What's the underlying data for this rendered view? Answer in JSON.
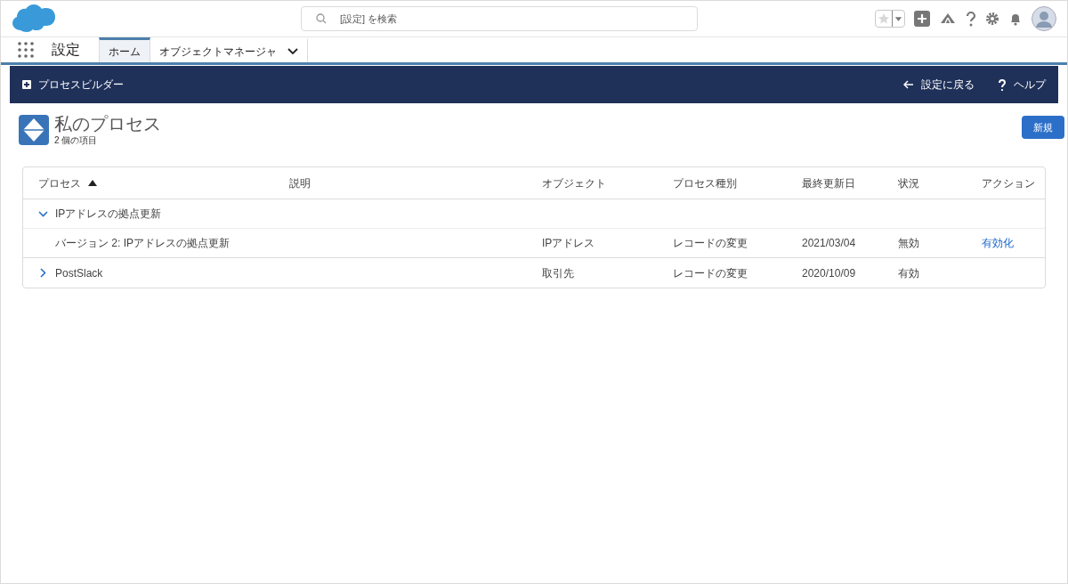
{
  "header": {
    "search": {
      "placeholder": "[設定] を検索"
    }
  },
  "nav": {
    "app_name": "設定",
    "tabs": [
      {
        "label": "ホーム",
        "selected": true,
        "has_menu": false
      },
      {
        "label": "オブジェクトマネージャ",
        "selected": false,
        "has_menu": true
      }
    ]
  },
  "banner": {
    "title": "プロセスビルダー",
    "links": [
      {
        "kind": "back",
        "label": "設定に戻る"
      },
      {
        "kind": "help",
        "label": "ヘルプ"
      }
    ]
  },
  "page": {
    "title": "私のプロセス",
    "subtitle": "2 個の項目",
    "new_button": "新規"
  },
  "table": {
    "columns": [
      {
        "label": "プロセス",
        "sorted": true
      },
      {
        "label": "説明",
        "sorted": false
      },
      {
        "label": "オブジェクト",
        "sorted": false
      },
      {
        "label": "プロセス種別",
        "sorted": false
      },
      {
        "label": "最終更新日",
        "sorted": false
      },
      {
        "label": "状況",
        "sorted": false
      },
      {
        "label": "アクション",
        "sorted": false
      }
    ],
    "rows": [
      {
        "name": "IPアドレスの拠点更新",
        "expanded": true,
        "children": [
          {
            "name": "バージョン 2: IPアドレスの拠点更新",
            "object": "IPアドレス",
            "type": "レコードの変更",
            "date": "2021/03/04",
            "status": "無効",
            "action": "有効化"
          }
        ]
      },
      {
        "name": "PostSlack",
        "expanded": false,
        "object": "取引先",
        "type": "レコードの変更",
        "date": "2020/10/09",
        "status": "有効"
      }
    ]
  }
}
